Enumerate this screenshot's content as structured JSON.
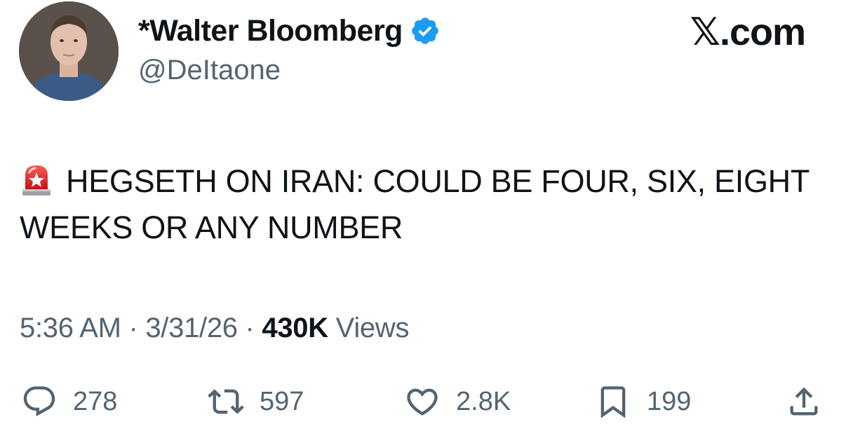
{
  "author": {
    "display_name": "*Walter Bloomberg",
    "handle": "@DeItaone",
    "verified_color": "#1d9bf0"
  },
  "brand": "𝕏.com",
  "tweet": {
    "emoji": "siren-icon",
    "text": "HEGSETH ON IRAN: COULD BE FOUR, SIX, EIGHT WEEKS OR ANY NUMBER"
  },
  "meta": {
    "time": "5:36 AM",
    "separator": "·",
    "date": "3/31/26",
    "views_count": "430K",
    "views_label": "Views"
  },
  "actions": {
    "replies": "278",
    "reposts": "597",
    "likes": "2.8K",
    "bookmarks": "199"
  },
  "colors": {
    "text": "#0f1419",
    "secondary": "#536471",
    "accent": "#1d9bf0"
  }
}
